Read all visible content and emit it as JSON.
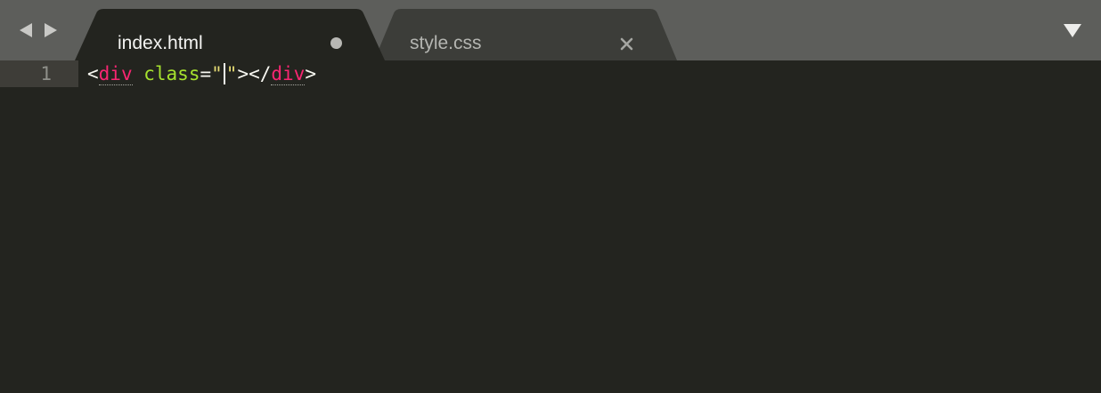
{
  "colors": {
    "tabbar_bg": "#5d5e5b",
    "active_tab_bg": "#23241f",
    "inactive_tab_bg": "#3c3d39",
    "editor_bg": "#23241f",
    "tag": "#f92672",
    "attribute": "#a6e22e",
    "string": "#e6db74",
    "punctuation": "#f8f8f2"
  },
  "navigation": {
    "back_icon": "triangle-left-icon",
    "forward_icon": "triangle-right-icon"
  },
  "tabs": [
    {
      "label": "index.html",
      "active": true,
      "modified": true,
      "indicator_icon": "unsaved-dot-icon"
    },
    {
      "label": "style.css",
      "active": false,
      "modified": false,
      "indicator_icon": "close-x-icon"
    }
  ],
  "tab_menu_icon": "triangle-down-icon",
  "editor": {
    "active_line_number": "1",
    "code": {
      "open_bracket": "<",
      "tag_name": "div",
      "space": " ",
      "attribute_name": "class",
      "equals": "=",
      "string_open_quote": "\"",
      "string_close_quote": "\"",
      "close_open_tag": ">",
      "end_tag_open": "</",
      "end_tag_name": "div",
      "end_tag_close": ">"
    }
  }
}
